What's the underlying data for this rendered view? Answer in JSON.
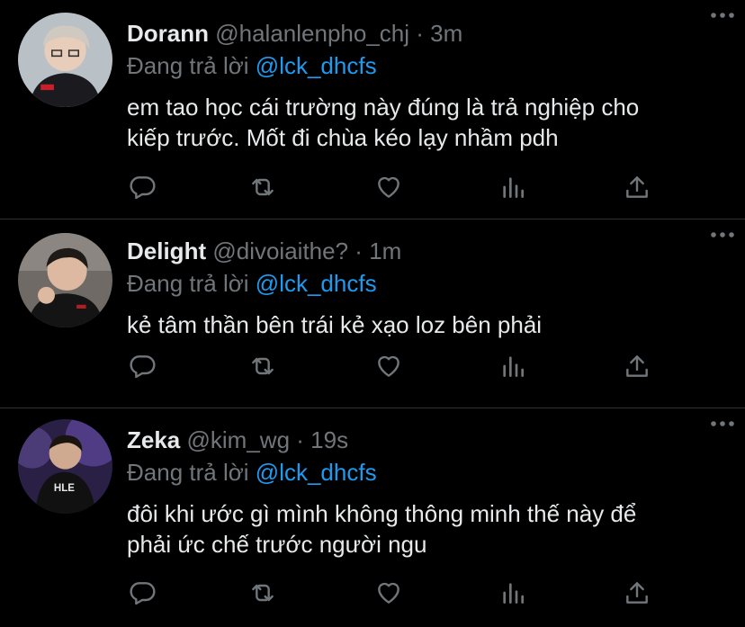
{
  "tweets": [
    {
      "name": "Dorann",
      "handle": "@halanlenpho_chj",
      "separator": "·",
      "time": "3m",
      "replying_prefix": "Đang trả lời",
      "replying_to": "@lck_dhcfs",
      "text_lines": [
        "em tao học cái trường này đúng là trả nghiệp cho",
        "kiếp trước. Mốt đi chùa kéo lạy nhầm pdh"
      ]
    },
    {
      "name": "Delight",
      "handle": "@divoiaithe?",
      "separator": "·",
      "time": "1m",
      "replying_prefix": "Đang trả lời",
      "replying_to": "@lck_dhcfs",
      "text_lines": [
        "kẻ tâm thần bên trái kẻ xạo loz bên phải"
      ]
    },
    {
      "name": "Zeka",
      "handle": "@kim_wg",
      "separator": "·",
      "time": "19s",
      "replying_prefix": "Đang trả lời",
      "replying_to": "@lck_dhcfs",
      "text_lines": [
        "đôi khi ước gì mình không thông minh thế này để",
        "phải ức chế trước người ngu"
      ]
    }
  ],
  "icons": {
    "more": "more-dots-icon",
    "reply": "reply-icon",
    "retweet": "retweet-icon",
    "like": "like-icon",
    "stats": "stats-icon",
    "share": "share-icon"
  },
  "colors": {
    "background": "#000000",
    "text": "#e7e9ea",
    "secondary": "#71767b",
    "accent": "#1d9bf0",
    "divider": "#2f3336"
  }
}
